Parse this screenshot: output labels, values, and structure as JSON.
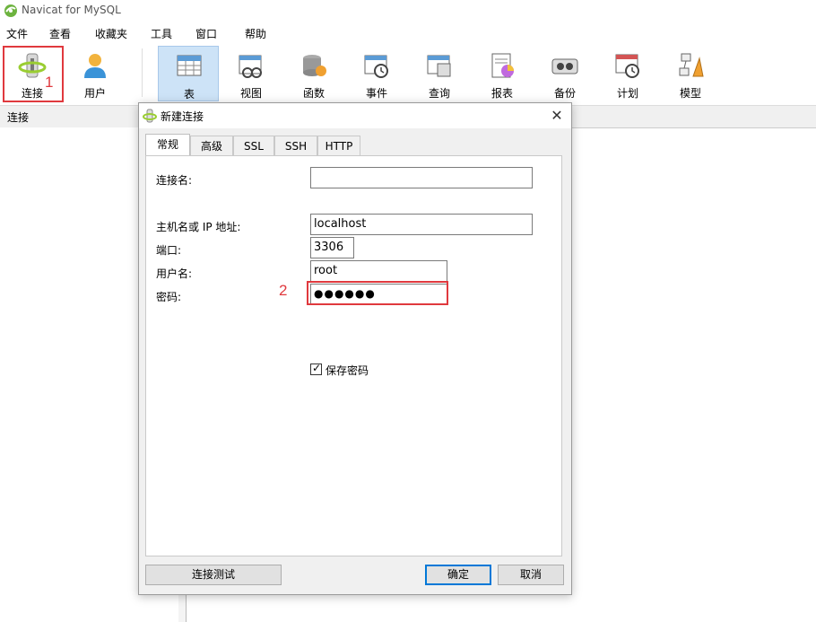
{
  "app": {
    "title": "Navicat for MySQL"
  },
  "menu": [
    "文件",
    "查看",
    "收藏夹",
    "工具",
    "窗口",
    "帮助"
  ],
  "toolbar": {
    "connect": "连接",
    "user": "用户",
    "table": "表",
    "view": "视图",
    "function": "函数",
    "event": "事件",
    "query": "查询",
    "report": "报表",
    "backup": "备份",
    "schedule": "计划",
    "model": "模型"
  },
  "annotations": {
    "step1": "1",
    "step2": "2"
  },
  "panel": {
    "header": "连接"
  },
  "dialog": {
    "title": "新建连接",
    "tabs": [
      "常规",
      "高级",
      "SSL",
      "SSH",
      "HTTP"
    ],
    "active_tab": "常规",
    "fields": {
      "connection_name": {
        "label": "连接名:",
        "value": ""
      },
      "host": {
        "label": "主机名或 IP 地址:",
        "value": "localhost"
      },
      "port": {
        "label": "端口:",
        "value": "3306"
      },
      "username": {
        "label": "用户名:",
        "value": "root"
      },
      "password": {
        "label": "密码:",
        "value": "●●●●●●"
      }
    },
    "save_password": {
      "label": "保存密码",
      "checked": true
    },
    "buttons": {
      "test": "连接测试",
      "ok": "确定",
      "cancel": "取消"
    }
  },
  "colors": {
    "annotation_red": "#e0393e",
    "active_tab_bg": "#cde3f7",
    "accent": "#0078d7"
  }
}
